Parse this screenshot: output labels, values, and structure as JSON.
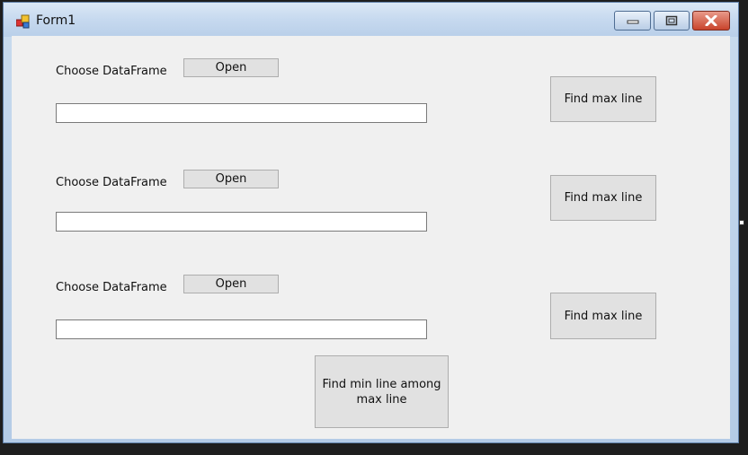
{
  "window": {
    "title": "Form1",
    "icons": {
      "app": "form-app-icon",
      "minimize": "minimize-icon",
      "maximize": "maximize-icon",
      "close": "close-icon"
    }
  },
  "form": {
    "rows": [
      {
        "label": "Choose DataFrame",
        "open_label": "Open",
        "path_value": "",
        "find_label": "Find max line"
      },
      {
        "label": "Choose DataFrame",
        "open_label": "Open",
        "path_value": "",
        "find_label": "Find max line"
      },
      {
        "label": "Choose DataFrame",
        "open_label": "Open",
        "path_value": "",
        "find_label": "Find max line"
      }
    ],
    "min_line_label": "Find min line among max line"
  }
}
